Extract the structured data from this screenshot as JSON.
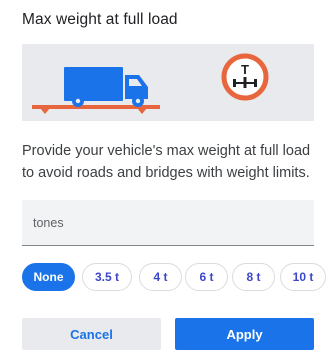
{
  "dialog": {
    "title": "Max weight at full load",
    "description": "Provide your vehicle's max weight at full load to avoid roads and bridges with weight limits.",
    "input": {
      "value": "",
      "placeholder": "tones"
    },
    "chips": [
      {
        "label": "None",
        "selected": true
      },
      {
        "label": "3.5 t",
        "selected": false
      },
      {
        "label": "4 t",
        "selected": false
      },
      {
        "label": "6 t",
        "selected": false
      },
      {
        "label": "8 t",
        "selected": false
      },
      {
        "label": "10 t",
        "selected": false
      }
    ],
    "buttons": {
      "cancel": "Cancel",
      "apply": "Apply"
    },
    "sign_label": "T"
  },
  "colors": {
    "accent": "#1a73e8",
    "truck": "#1a73e8",
    "scale": "#e8663e",
    "sign_ring": "#e8663e",
    "panel": "#e8eaed",
    "chip_text": "#3b48c9"
  },
  "icons": {
    "truck": "truck-icon",
    "scale": "scale-platform-icon",
    "sign": "weight-limit-sign-icon"
  }
}
